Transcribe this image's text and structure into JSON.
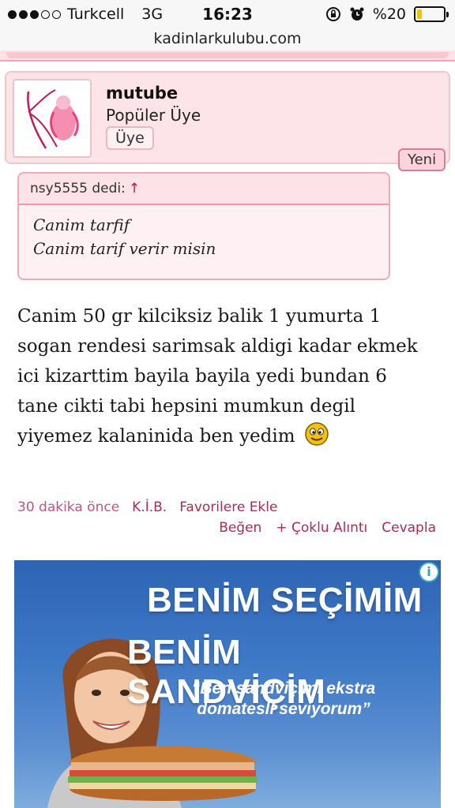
{
  "status_bar": {
    "carrier": "Turkcell",
    "network": "3G",
    "time": "16:23",
    "battery_text": "%20",
    "battery_level": 0.2,
    "battery_color": "#f5c400"
  },
  "browser": {
    "url": "kadinlarkulubu.com"
  },
  "user": {
    "name": "mutube",
    "rank": "Popüler Üye",
    "badge": "Üye",
    "new_label": "Yeni"
  },
  "quote": {
    "author": "nsy5555 dedi:",
    "lines": [
      "Canim tarfif",
      "Canim tarif verir misin"
    ]
  },
  "message": {
    "text": "Canim 50 gr kilciksiz balik 1 yumurta 1 sogan rendesi sarimsak aldigi kadar ekmek ici kizarttim bayila bayila yedi bundan 6 tane cikti tabi hepsini mumkun degil yiyemez kalaninida ben yedim",
    "smiley_icon": "smiley-icon"
  },
  "meta": {
    "time_ago": "30 dakika önce",
    "kib": "K.İ.B.",
    "favorite": "Favorilere Ekle"
  },
  "actions": {
    "like": "Beğen",
    "multi_quote": "+ Çoklu Alıntı",
    "reply": "Cevapla"
  },
  "ad": {
    "headline1": "BENİM SEÇİMİM",
    "headline2": "BENİM SANDVİÇİM",
    "quote": "“Ben sandviçimi ekstra domatesli seviyorum”",
    "info_icon": "info-icon"
  },
  "colors": {
    "link": "#b02a52",
    "card_bg": "#fde4e9",
    "quote_border": "#f0a9b8"
  }
}
